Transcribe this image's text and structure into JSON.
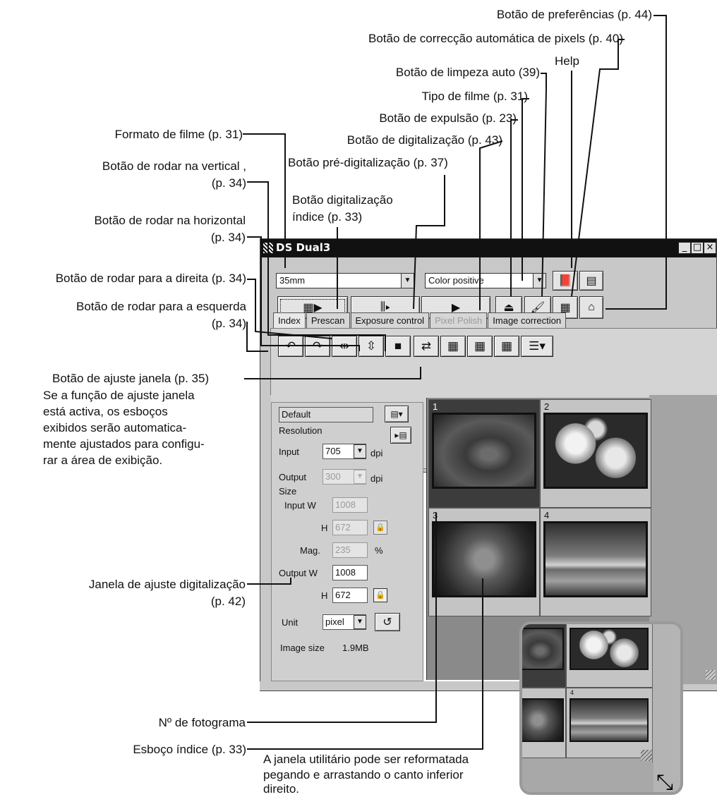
{
  "annotations": {
    "prefs": "Botão de preferências (p. 44)",
    "autopixel": "Botão de correcção automática de pixels (p. 40)",
    "help": "Help",
    "autoclean": "Botão de limpeza auto (39)",
    "filmtype": "Tipo de filme (p. 31)",
    "eject": "Botão de expulsão (p. 23)",
    "filmformat": "Formato de filme (p. 31)",
    "scan": "Botão de digitalização (p. 43)",
    "rotvert_1": "Botão de rodar na vertical ,",
    "rotvert_2": "(p. 34)",
    "prescan": "Botão pré-digitalização (p. 37)",
    "indexscan_1": "Botão digitalização",
    "indexscan_2": "índice (p. 33)",
    "rothoriz_1": "Botão de rodar na horizontal",
    "rothoriz_2": "(p. 34)",
    "rotright": "Botão de rodar para a direita (p. 34)",
    "rotleft_1": "Botão de rodar para a esquerda",
    "rotleft_2": "(p. 34)",
    "fitwin_1": "Botão de ajuste janela (p. 35)",
    "fitwin_2": "Se a função de ajuste janela",
    "fitwin_3": "está activa, os esboços",
    "fitwin_4": "exibidos serão automatica-",
    "fitwin_5": "mente ajustados para configu-",
    "fitwin_6": "rar a área de exibição.",
    "scanset_1": "Janela de ajuste digitalização",
    "scanset_2": "(p. 42)",
    "frameno": "Nº de fotograma",
    "thumb": "Esboço índice (p. 33)",
    "resize_1": "A janela utilitário pode ser reformatada",
    "resize_2": "pegando e arrastando o canto inferior",
    "resize_3": "direito."
  },
  "window": {
    "title": "DS Dual3",
    "film_format": "35mm",
    "film_type": "Color positive",
    "tabs": [
      "Index",
      "Prescan",
      "Exposure control",
      "Pixel Polish",
      "Image correction"
    ],
    "active_tab": "Index",
    "disabled_tab": "Pixel Polish",
    "settings": {
      "job": "Default",
      "resolution_label": "Resolution",
      "input_label": "Input",
      "input_dpi": "705",
      "output_label": "Output",
      "output_dpi": "300",
      "dpi": "dpi",
      "size_label": "Size",
      "input_w_label": "Input W",
      "input_w": "1008",
      "h_label": "H",
      "input_h": "672",
      "mag_label": "Mag.",
      "mag": "235",
      "pct": "%",
      "output_w_label": "Output W",
      "output_w": "1008",
      "output_h": "672",
      "unit_label": "Unit",
      "unit": "pixel",
      "image_size_label": "Image size",
      "image_size": "1.9MB"
    },
    "frames": [
      "1",
      "2",
      "3",
      "4"
    ]
  },
  "inset": {
    "frame_no": "4"
  }
}
